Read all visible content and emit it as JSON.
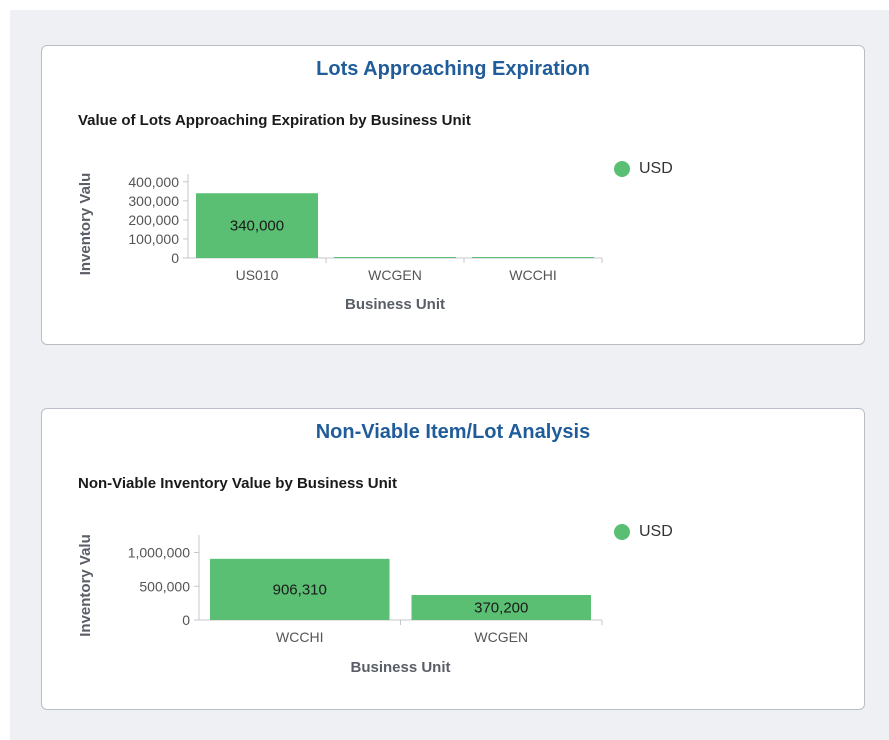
{
  "panels": [
    {
      "title": "Lots Approaching Expiration",
      "legend_label": "USD",
      "chart_data": {
        "type": "bar",
        "title": "Value of Lots Approaching Expiration by Business Unit",
        "xlabel": "Business Unit",
        "ylabel": "Inventory Valu",
        "categories": [
          "US010",
          "WCGEN",
          "WCCHI"
        ],
        "series": [
          {
            "name": "USD",
            "values": [
              340000,
              4000,
              1000
            ]
          }
        ],
        "data_labels": [
          "340,000",
          "",
          ""
        ],
        "yticks": [
          0,
          100000,
          200000,
          300000,
          400000
        ],
        "ytick_labels": [
          "0",
          "100,000",
          "200,000",
          "300,000",
          "400,000"
        ],
        "ylim": [
          0,
          420000
        ],
        "grid": false,
        "legend": "right",
        "color": "#5abf72"
      }
    },
    {
      "title": "Non-Viable Item/Lot Analysis",
      "legend_label": "USD",
      "chart_data": {
        "type": "bar",
        "title": "Non-Viable Inventory Value by Business Unit",
        "xlabel": "Business Unit",
        "ylabel": "Inventory Valu",
        "categories": [
          "WCCHI",
          "WCGEN"
        ],
        "series": [
          {
            "name": "USD",
            "values": [
              906310,
              370200
            ]
          }
        ],
        "data_labels": [
          "906,310",
          "370,200"
        ],
        "yticks": [
          0,
          500000,
          1000000
        ],
        "ytick_labels": [
          "0",
          "500,000",
          "1,000,000"
        ],
        "ylim": [
          0,
          1200000
        ],
        "grid": false,
        "legend": "right",
        "color": "#5abf72"
      }
    }
  ]
}
